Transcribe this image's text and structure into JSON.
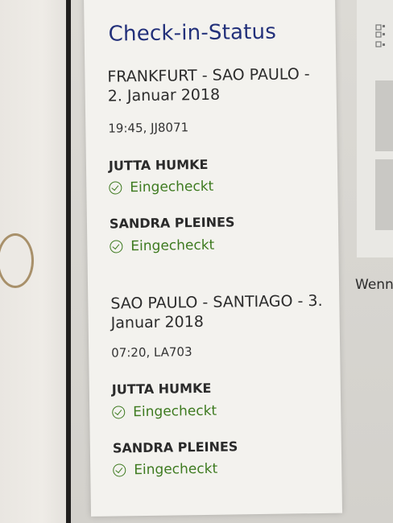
{
  "card": {
    "title": "Check-in-Status",
    "flights": [
      {
        "route": "FRANKFURT - SAO PAULO - 2. Januar 2018",
        "flight_info": "19:45, JJ8071",
        "passengers": [
          {
            "name": "JUTTA HUMKE",
            "status": "Eingecheckt"
          },
          {
            "name": "SANDRA PLEINES",
            "status": "Eingecheckt"
          }
        ]
      },
      {
        "route": "SAO PAULO - SANTIAGO - 3. Januar 2018",
        "flight_info": "07:20, LA703",
        "passengers": [
          {
            "name": "JUTTA HUMKE",
            "status": "Eingecheckt"
          },
          {
            "name": "SANDRA PLEINES",
            "status": "Eingecheckt"
          }
        ]
      }
    ]
  },
  "right_panel": {
    "partial_text": "Wenn",
    "icon": "qr-code-icon"
  },
  "colors": {
    "title": "#22307a",
    "status_green": "#3d7a1f"
  }
}
